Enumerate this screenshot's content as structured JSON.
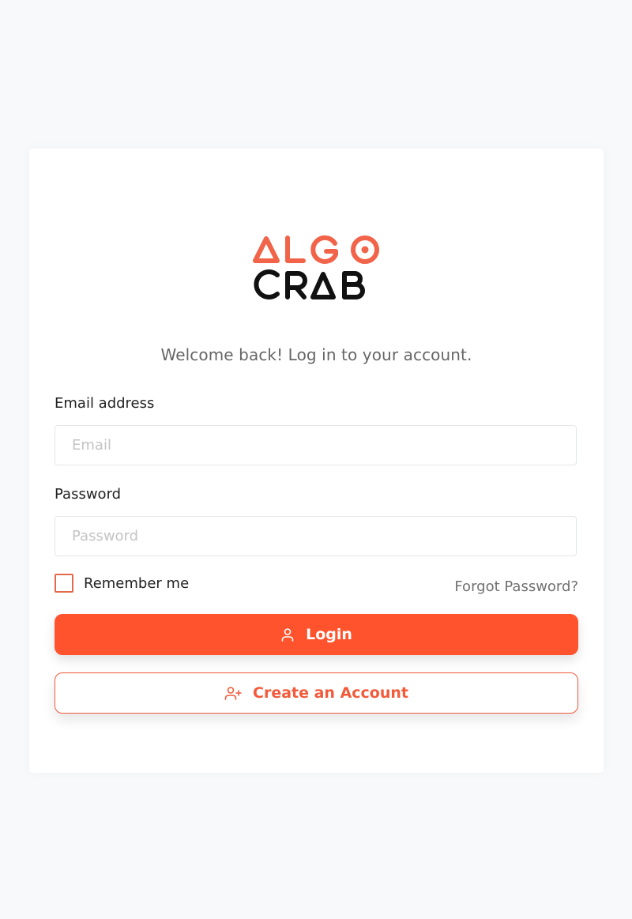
{
  "brand": {
    "line1": "ALGO",
    "line2": "CRAB",
    "accent_color": "#f2644a",
    "dark_color": "#111111"
  },
  "welcome_text": "Welcome back! Log in to your account.",
  "form": {
    "email": {
      "label": "Email address",
      "placeholder": "Email",
      "value": ""
    },
    "password": {
      "label": "Password",
      "placeholder": "Password",
      "value": ""
    },
    "remember_me": {
      "label": "Remember me",
      "checked": false
    },
    "forgot_password": "Forgot Password?"
  },
  "buttons": {
    "login": {
      "label": "Login",
      "icon": "user-icon"
    },
    "create_account": {
      "label": "Create an Account",
      "icon": "user-plus-icon"
    }
  },
  "colors": {
    "primary": "#ff532d",
    "background": "#f8f9fb"
  }
}
